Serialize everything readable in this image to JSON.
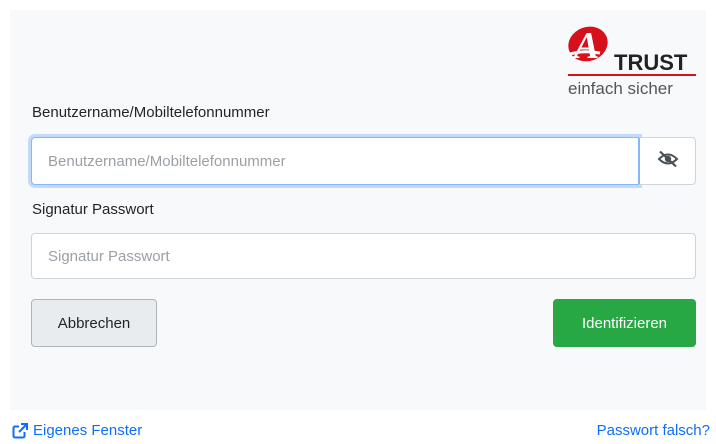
{
  "logo": {
    "letter": "A",
    "brand": "TRUST",
    "tagline": "einfach sicher",
    "colors": {
      "red": "#d6111b",
      "dark": "#222222",
      "text": "#555555"
    }
  },
  "form": {
    "username": {
      "label": "Benutzername/Mobiltelefonnummer",
      "placeholder": "Benutzername/Mobiltelefonnummer",
      "value": "",
      "toggle_icon": "eye-slash-icon"
    },
    "password": {
      "label": "Signatur Passwort",
      "placeholder": "Signatur Passwort",
      "value": ""
    }
  },
  "buttons": {
    "cancel": "Abbrechen",
    "submit": "Identifizieren",
    "submit_color": "#28a745"
  },
  "footer": {
    "own_window": "Eigenes Fenster",
    "own_window_icon": "external-link-icon",
    "forgot_password": "Passwort falsch?",
    "link_color": "#0d6efd"
  }
}
